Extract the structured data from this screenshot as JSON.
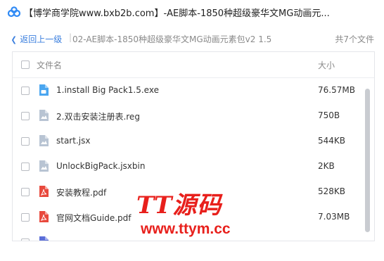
{
  "window": {
    "title": "【博学商学院www.bxb2b.com】-AE脚本-1850种超级豪华文MG动画元..."
  },
  "pathbar": {
    "back_label": "返回上一级",
    "separator": "|",
    "path": "02-AE脚本-1850种超级豪华文MG动画元素包v2 1.5",
    "count": "共7个文件"
  },
  "list": {
    "header_name": "文件名",
    "header_size": "大小",
    "files": [
      {
        "name": "1.install Big Pack1.5.exe",
        "size": "76.57MB",
        "icon": "exe-file-icon",
        "color": "#4aa6f0"
      },
      {
        "name": "2.双击安装注册表.reg",
        "size": "750B",
        "icon": "generic-file-icon",
        "color": "#b8c4d3"
      },
      {
        "name": "start.jsx",
        "size": "544KB",
        "icon": "generic-file-icon",
        "color": "#b8c4d3"
      },
      {
        "name": "UnlockBigPack.jsxbin",
        "size": "2KB",
        "icon": "generic-file-icon",
        "color": "#b8c4d3"
      },
      {
        "name": "安装教程.pdf",
        "size": "528KB",
        "icon": "pdf-file-icon",
        "color": "#e8493d"
      },
      {
        "name": "官网文档Guide.pdf",
        "size": "7.03MB",
        "icon": "pdf-file-icon",
        "color": "#e8493d"
      }
    ],
    "partial_file": {
      "icon": "doc-file-icon",
      "color": "#5b6ed8"
    }
  },
  "watermark": {
    "line1": "TT源码",
    "line2": "www.ttym.cc"
  }
}
